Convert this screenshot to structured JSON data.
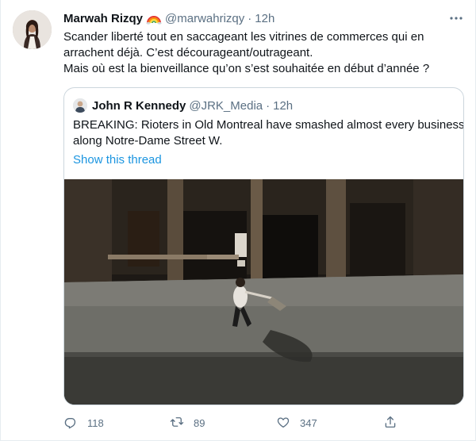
{
  "tweet": {
    "author": {
      "display_name": "Marwah Rizqy",
      "name_emoji": "rainbow-emoji",
      "handle": "@marwahrizqy",
      "separator": "·",
      "time": "12h"
    },
    "more_icon": "more-dots-icon",
    "text_lines": [
      "Scander liberté tout en saccageant les vitrines de commerces qui en",
      "arrachent déjà. C’est décourageant/outrageant.",
      "Mais où est la bienveillance qu’on s’est souhaitée en début d’année ?"
    ]
  },
  "quoted": {
    "author": {
      "display_name": "John R Kennedy",
      "handle": "@JRK_Media",
      "separator": "·",
      "time": "12h"
    },
    "text_lines": [
      "BREAKING: Rioters in Old Montreal have smashed almost every business",
      "along Notre-Dame Street W."
    ],
    "show_thread_label": "Show this thread",
    "media": {
      "kind": "video-still",
      "description_icon": "street-night-scene"
    }
  },
  "actions": {
    "reply": {
      "icon": "reply-icon",
      "count": "118"
    },
    "retweet": {
      "icon": "retweet-icon",
      "count": "89"
    },
    "like": {
      "icon": "heart-icon",
      "count": "347"
    },
    "share": {
      "icon": "share-icon"
    }
  },
  "colors": {
    "text_primary": "#0f1419",
    "text_secondary": "#5b7083",
    "link": "#1b95e0",
    "border": "#ccd6dd"
  }
}
